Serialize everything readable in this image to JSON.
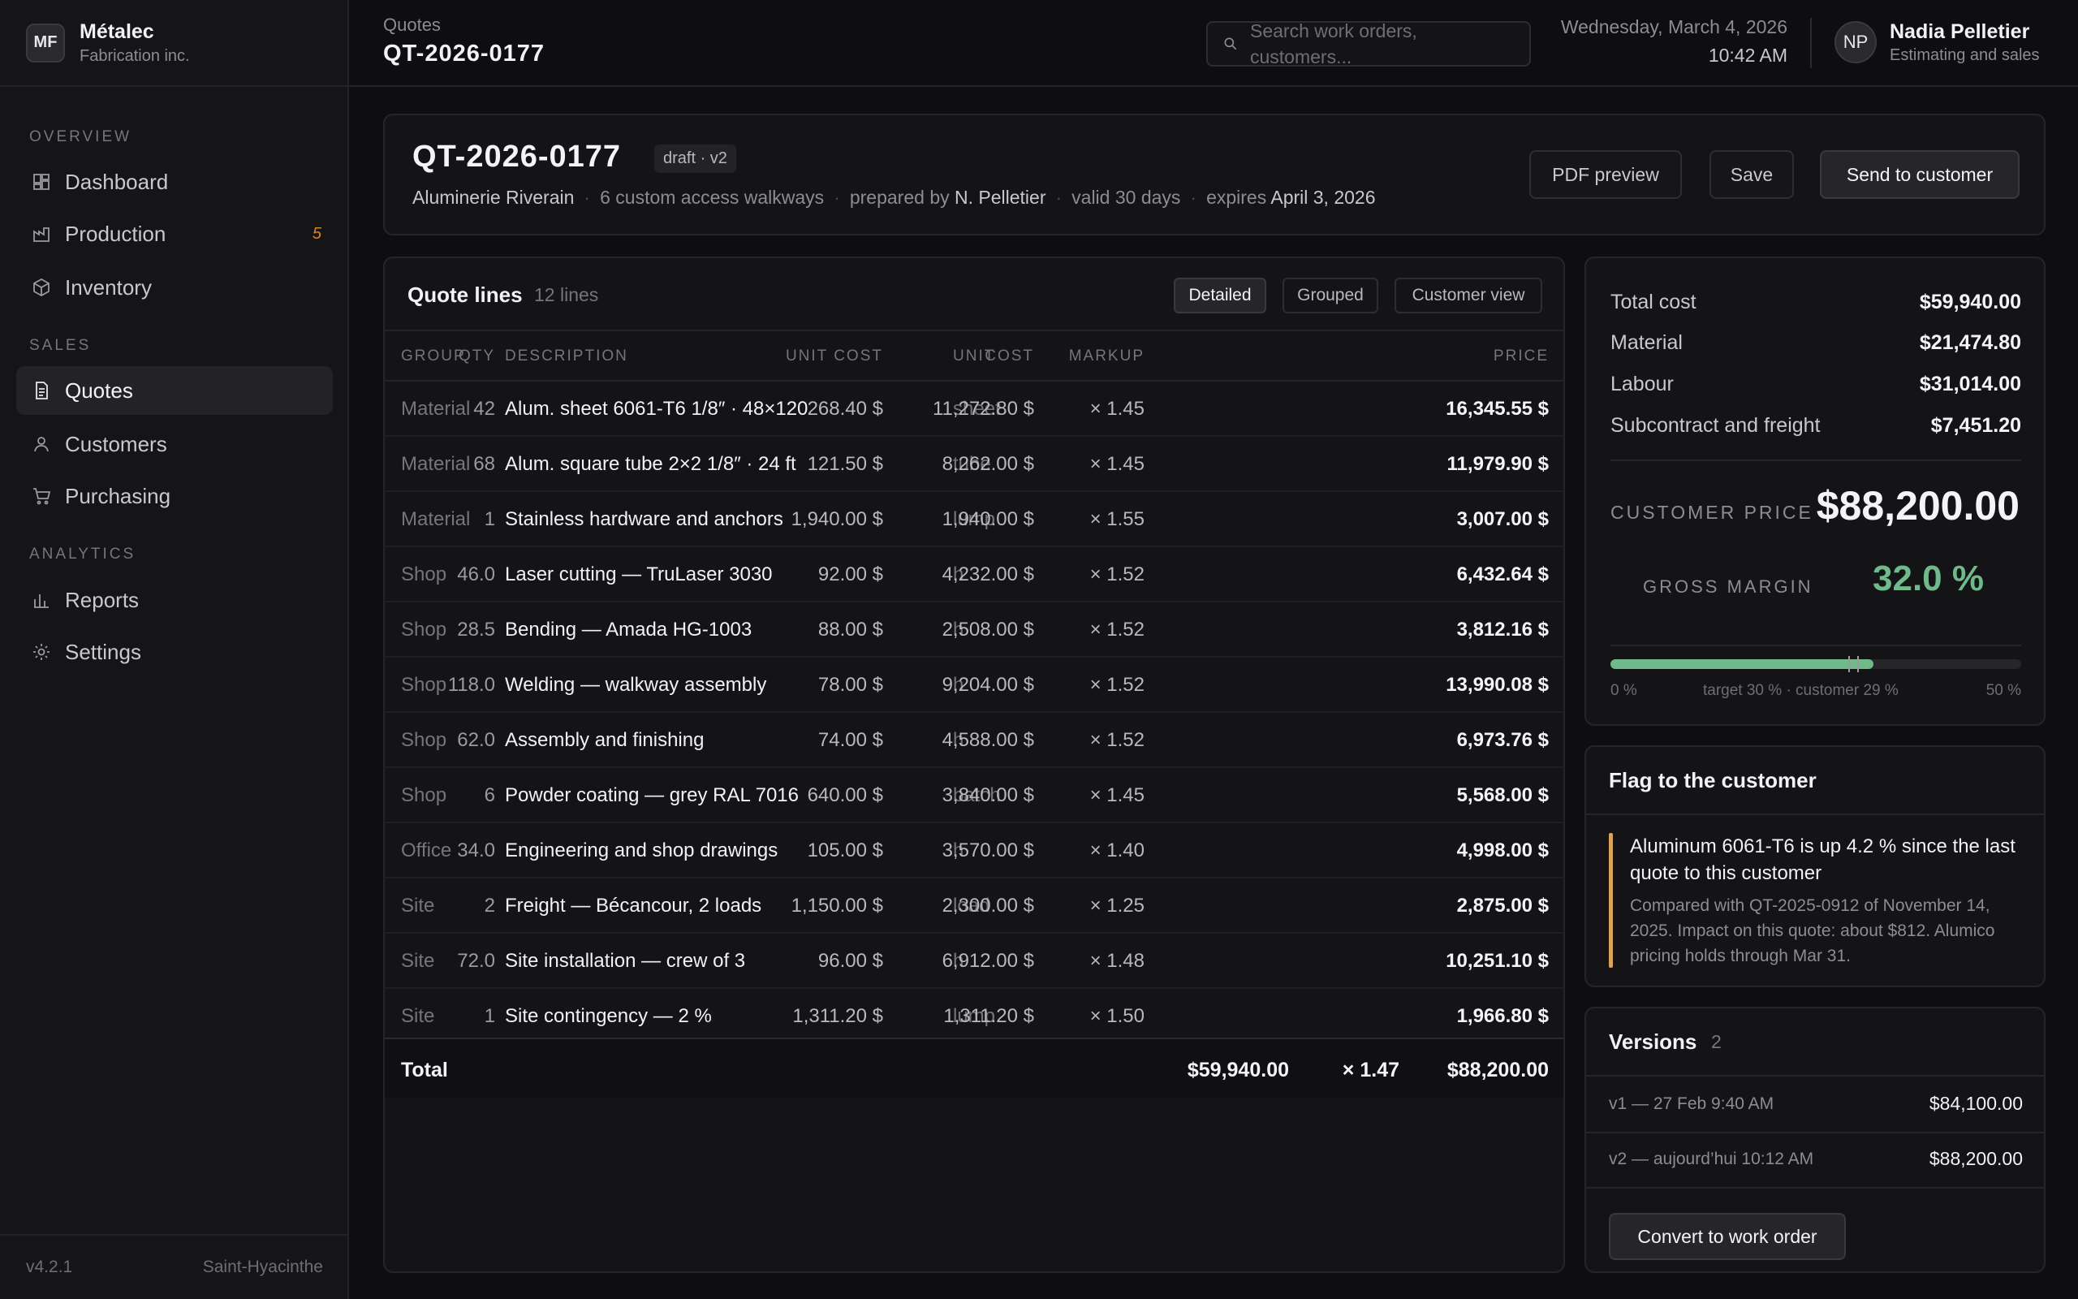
{
  "brand": {
    "initials": "MF",
    "name": "Métalec",
    "sub": "Fabrication inc."
  },
  "nav": {
    "sections": [
      "OVERVIEW",
      "SALES",
      "ANALYTICS"
    ],
    "items": [
      {
        "label": "Dashboard",
        "icon": "dashboard-icon"
      },
      {
        "label": "Production",
        "icon": "factory-icon",
        "badge": "5"
      },
      {
        "label": "Inventory",
        "icon": "box-icon"
      },
      {
        "label": "Quotes",
        "icon": "document-icon",
        "active": true
      },
      {
        "label": "Customers",
        "icon": "user-icon"
      },
      {
        "label": "Purchasing",
        "icon": "cart-icon"
      },
      {
        "label": "Reports",
        "icon": "bar-chart-icon"
      },
      {
        "label": "Settings",
        "icon": "gear-icon"
      }
    ],
    "footer": {
      "version": "v4.2.1",
      "location": "Saint-Hyacinthe"
    }
  },
  "topbar": {
    "breadcrumb": "Quotes",
    "title": "QT-2026-0177",
    "search_placeholder": "Search work orders, customers...",
    "date": "Wednesday, March 4, 2026",
    "time": "10:42 AM",
    "user": {
      "initials": "NP",
      "name": "Nadia Pelletier",
      "role": "Estimating and sales"
    }
  },
  "quote": {
    "id": "QT-2026-0177",
    "badge": "draft · v2",
    "customer": "Aluminerie Riverain",
    "summary": "6 custom access walkways",
    "prepared_label": "prepared by",
    "prepared_by": "N. Pelletier",
    "validity": "valid 30 days",
    "expires_label": "expires",
    "expires": "April 3, 2026",
    "buttons": {
      "pdf": "PDF preview",
      "save": "Save",
      "send": "Send to customer"
    }
  },
  "lines": {
    "title": "Quote lines",
    "count": "12 lines",
    "views": [
      "Detailed",
      "Grouped",
      "Customer view"
    ],
    "active_view": "Detailed",
    "columns": [
      "GROUP",
      "DESCRIPTION",
      "QTY",
      "UNIT",
      "UNIT COST",
      "COST",
      "MARKUP",
      "PRICE"
    ],
    "rows": [
      {
        "group": "Material",
        "desc": "Alum. sheet 6061-T6 1/8″ · 48×120",
        "qty": "42",
        "unit": "sheet",
        "ucost": "268.40 $",
        "cost": "11,272.80 $",
        "markup": "× 1.45",
        "price": "16,345.55 $"
      },
      {
        "group": "Material",
        "desc": "Alum. square tube 2×2 1/8″ · 24 ft",
        "qty": "68",
        "unit": "tube",
        "ucost": "121.50 $",
        "cost": "8,262.00 $",
        "markup": "× 1.45",
        "price": "11,979.90 $"
      },
      {
        "group": "Material",
        "desc": "Stainless hardware and anchors",
        "qty": "1",
        "unit": "lump",
        "ucost": "1,940.00 $",
        "cost": "1,940.00 $",
        "markup": "× 1.55",
        "price": "3,007.00 $"
      },
      {
        "group": "Shop",
        "desc": "Laser cutting — TruLaser 3030",
        "qty": "46.0",
        "unit": "h",
        "ucost": "92.00 $",
        "cost": "4,232.00 $",
        "markup": "× 1.52",
        "price": "6,432.64 $"
      },
      {
        "group": "Shop",
        "desc": "Bending — Amada HG-1003",
        "qty": "28.5",
        "unit": "h",
        "ucost": "88.00 $",
        "cost": "2,508.00 $",
        "markup": "× 1.52",
        "price": "3,812.16 $"
      },
      {
        "group": "Shop",
        "desc": "Welding — walkway assembly",
        "qty": "118.0",
        "unit": "h",
        "ucost": "78.00 $",
        "cost": "9,204.00 $",
        "markup": "× 1.52",
        "price": "13,990.08 $"
      },
      {
        "group": "Shop",
        "desc": "Assembly and finishing",
        "qty": "62.0",
        "unit": "h",
        "ucost": "74.00 $",
        "cost": "4,588.00 $",
        "markup": "× 1.52",
        "price": "6,973.76 $"
      },
      {
        "group": "Shop",
        "desc": "Powder coating — grey RAL 7016",
        "qty": "6",
        "unit": "batch",
        "ucost": "640.00 $",
        "cost": "3,840.00 $",
        "markup": "× 1.45",
        "price": "5,568.00 $"
      },
      {
        "group": "Office",
        "desc": "Engineering and shop drawings",
        "qty": "34.0",
        "unit": "h",
        "ucost": "105.00 $",
        "cost": "3,570.00 $",
        "markup": "× 1.40",
        "price": "4,998.00 $"
      },
      {
        "group": "Site",
        "desc": "Freight — Bécancour, 2 loads",
        "qty": "2",
        "unit": "load",
        "ucost": "1,150.00 $",
        "cost": "2,300.00 $",
        "markup": "× 1.25",
        "price": "2,875.00 $"
      },
      {
        "group": "Site",
        "desc": "Site installation — crew of 3",
        "qty": "72.0",
        "unit": "h",
        "ucost": "96.00 $",
        "cost": "6,912.00 $",
        "markup": "× 1.48",
        "price": "10,251.10 $"
      },
      {
        "group": "Site",
        "desc": "Site contingency — 2 %",
        "qty": "1",
        "unit": "lump",
        "ucost": "1,311.20 $",
        "cost": "1,311.20 $",
        "markup": "× 1.50",
        "price": "1,966.80 $"
      }
    ],
    "total": {
      "label": "Total",
      "cost": "$59,940.00",
      "markup": "× 1.47",
      "price": "$88,200.00"
    }
  },
  "summary": {
    "rows": [
      {
        "label": "Total cost",
        "value": "$59,940.00"
      },
      {
        "label": "Material",
        "value": "$21,474.80"
      },
      {
        "label": "Labour",
        "value": "$31,014.00"
      },
      {
        "label": "Subcontract and freight",
        "value": "$7,451.20"
      }
    ],
    "customer_price_label": "CUSTOMER PRICE",
    "customer_price": "$88,200.00",
    "gross_margin_label": "GROSS MARGIN",
    "gross_margin": "32.0 %",
    "margin_bar": {
      "min": 0,
      "max": 50,
      "value": 32.0,
      "target": 30,
      "customer": 29
    },
    "bar_labels": {
      "min": "0 %",
      "mid": "target 30 % · customer 29 %",
      "max": "50 %"
    },
    "accent_color": "#6fb98a"
  },
  "flag": {
    "title": "Flag to the customer",
    "headline": "Aluminum 6061-T6 is up 4.2 % since the last quote to this customer",
    "body": "Compared with QT-2025-0912 of November 14, 2025. Impact on this quote: about $812. Alumico pricing holds through Mar 31.",
    "accent_color": "#d9a35a"
  },
  "versions": {
    "title": "Versions",
    "count": "2",
    "items": [
      {
        "label": "v1 — 27 Feb 9:40 AM",
        "value": "$84,100.00"
      },
      {
        "label": "v2 — aujourd’hui 10:12 AM",
        "value": "$88,200.00"
      }
    ],
    "convert_label": "Convert to work order"
  }
}
